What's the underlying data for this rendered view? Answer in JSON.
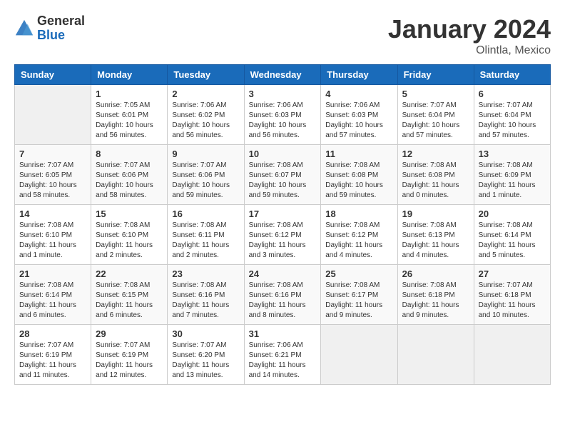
{
  "header": {
    "logo_general": "General",
    "logo_blue": "Blue",
    "month": "January 2024",
    "location": "Olintla, Mexico"
  },
  "weekdays": [
    "Sunday",
    "Monday",
    "Tuesday",
    "Wednesday",
    "Thursday",
    "Friday",
    "Saturday"
  ],
  "weeks": [
    [
      {
        "day": "",
        "info": ""
      },
      {
        "day": "1",
        "info": "Sunrise: 7:05 AM\nSunset: 6:01 PM\nDaylight: 10 hours\nand 56 minutes."
      },
      {
        "day": "2",
        "info": "Sunrise: 7:06 AM\nSunset: 6:02 PM\nDaylight: 10 hours\nand 56 minutes."
      },
      {
        "day": "3",
        "info": "Sunrise: 7:06 AM\nSunset: 6:03 PM\nDaylight: 10 hours\nand 56 minutes."
      },
      {
        "day": "4",
        "info": "Sunrise: 7:06 AM\nSunset: 6:03 PM\nDaylight: 10 hours\nand 57 minutes."
      },
      {
        "day": "5",
        "info": "Sunrise: 7:07 AM\nSunset: 6:04 PM\nDaylight: 10 hours\nand 57 minutes."
      },
      {
        "day": "6",
        "info": "Sunrise: 7:07 AM\nSunset: 6:04 PM\nDaylight: 10 hours\nand 57 minutes."
      }
    ],
    [
      {
        "day": "7",
        "info": "Sunrise: 7:07 AM\nSunset: 6:05 PM\nDaylight: 10 hours\nand 58 minutes."
      },
      {
        "day": "8",
        "info": "Sunrise: 7:07 AM\nSunset: 6:06 PM\nDaylight: 10 hours\nand 58 minutes."
      },
      {
        "day": "9",
        "info": "Sunrise: 7:07 AM\nSunset: 6:06 PM\nDaylight: 10 hours\nand 59 minutes."
      },
      {
        "day": "10",
        "info": "Sunrise: 7:08 AM\nSunset: 6:07 PM\nDaylight: 10 hours\nand 59 minutes."
      },
      {
        "day": "11",
        "info": "Sunrise: 7:08 AM\nSunset: 6:08 PM\nDaylight: 10 hours\nand 59 minutes."
      },
      {
        "day": "12",
        "info": "Sunrise: 7:08 AM\nSunset: 6:08 PM\nDaylight: 11 hours\nand 0 minutes."
      },
      {
        "day": "13",
        "info": "Sunrise: 7:08 AM\nSunset: 6:09 PM\nDaylight: 11 hours\nand 1 minute."
      }
    ],
    [
      {
        "day": "14",
        "info": "Sunrise: 7:08 AM\nSunset: 6:10 PM\nDaylight: 11 hours\nand 1 minute."
      },
      {
        "day": "15",
        "info": "Sunrise: 7:08 AM\nSunset: 6:10 PM\nDaylight: 11 hours\nand 2 minutes."
      },
      {
        "day": "16",
        "info": "Sunrise: 7:08 AM\nSunset: 6:11 PM\nDaylight: 11 hours\nand 2 minutes."
      },
      {
        "day": "17",
        "info": "Sunrise: 7:08 AM\nSunset: 6:12 PM\nDaylight: 11 hours\nand 3 minutes."
      },
      {
        "day": "18",
        "info": "Sunrise: 7:08 AM\nSunset: 6:12 PM\nDaylight: 11 hours\nand 4 minutes."
      },
      {
        "day": "19",
        "info": "Sunrise: 7:08 AM\nSunset: 6:13 PM\nDaylight: 11 hours\nand 4 minutes."
      },
      {
        "day": "20",
        "info": "Sunrise: 7:08 AM\nSunset: 6:14 PM\nDaylight: 11 hours\nand 5 minutes."
      }
    ],
    [
      {
        "day": "21",
        "info": "Sunrise: 7:08 AM\nSunset: 6:14 PM\nDaylight: 11 hours\nand 6 minutes."
      },
      {
        "day": "22",
        "info": "Sunrise: 7:08 AM\nSunset: 6:15 PM\nDaylight: 11 hours\nand 6 minutes."
      },
      {
        "day": "23",
        "info": "Sunrise: 7:08 AM\nSunset: 6:16 PM\nDaylight: 11 hours\nand 7 minutes."
      },
      {
        "day": "24",
        "info": "Sunrise: 7:08 AM\nSunset: 6:16 PM\nDaylight: 11 hours\nand 8 minutes."
      },
      {
        "day": "25",
        "info": "Sunrise: 7:08 AM\nSunset: 6:17 PM\nDaylight: 11 hours\nand 9 minutes."
      },
      {
        "day": "26",
        "info": "Sunrise: 7:08 AM\nSunset: 6:18 PM\nDaylight: 11 hours\nand 9 minutes."
      },
      {
        "day": "27",
        "info": "Sunrise: 7:07 AM\nSunset: 6:18 PM\nDaylight: 11 hours\nand 10 minutes."
      }
    ],
    [
      {
        "day": "28",
        "info": "Sunrise: 7:07 AM\nSunset: 6:19 PM\nDaylight: 11 hours\nand 11 minutes."
      },
      {
        "day": "29",
        "info": "Sunrise: 7:07 AM\nSunset: 6:19 PM\nDaylight: 11 hours\nand 12 minutes."
      },
      {
        "day": "30",
        "info": "Sunrise: 7:07 AM\nSunset: 6:20 PM\nDaylight: 11 hours\nand 13 minutes."
      },
      {
        "day": "31",
        "info": "Sunrise: 7:06 AM\nSunset: 6:21 PM\nDaylight: 11 hours\nand 14 minutes."
      },
      {
        "day": "",
        "info": ""
      },
      {
        "day": "",
        "info": ""
      },
      {
        "day": "",
        "info": ""
      }
    ]
  ]
}
